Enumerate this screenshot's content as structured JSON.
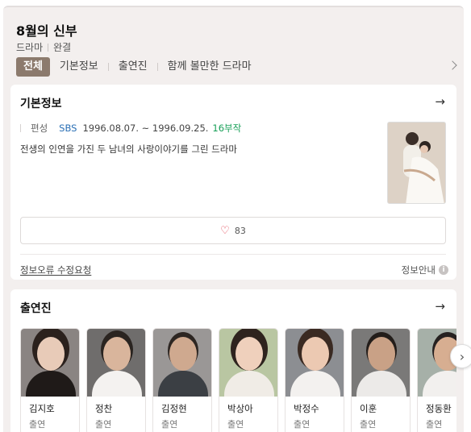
{
  "header": {
    "title": "8월의 신부",
    "genre": "드라마",
    "status": "완결"
  },
  "tabs": [
    {
      "label": "전체"
    },
    {
      "label": "기본정보"
    },
    {
      "label": "출연진"
    },
    {
      "label": "함께 볼만한 드라마"
    }
  ],
  "basic": {
    "heading": "기본정보",
    "meta_label": "편성",
    "network": "SBS",
    "dates": "1996.08.07. ~ 1996.09.25.",
    "episodes": "16부작",
    "description": "전생의 인연을 가진 두 남녀의 사랑이야기를 그린 드라마",
    "likes": "83",
    "report_link": "정보오류 수정요청",
    "info_guide": "정보안내"
  },
  "cast_section": {
    "heading": "출연진",
    "members": [
      {
        "name": "김지호",
        "role": "출연"
      },
      {
        "name": "정찬",
        "role": "출연"
      },
      {
        "name": "김정현",
        "role": "출연"
      },
      {
        "name": "박상아",
        "role": "출연"
      },
      {
        "name": "박정수",
        "role": "출연"
      },
      {
        "name": "이훈",
        "role": "출연"
      },
      {
        "name": "정동환",
        "role": "출연"
      }
    ]
  },
  "colors": {
    "active_tab": "#8c7a6d",
    "network": "#2a6fb5",
    "episodes": "#18a058",
    "heart": "#e03b4b"
  },
  "icons": {
    "tabs_scroll": "chevron-right-icon",
    "section_more": "arrow-right-icon",
    "like": "heart-icon",
    "info": "info-icon",
    "cast_next": "chevron-right-icon"
  }
}
